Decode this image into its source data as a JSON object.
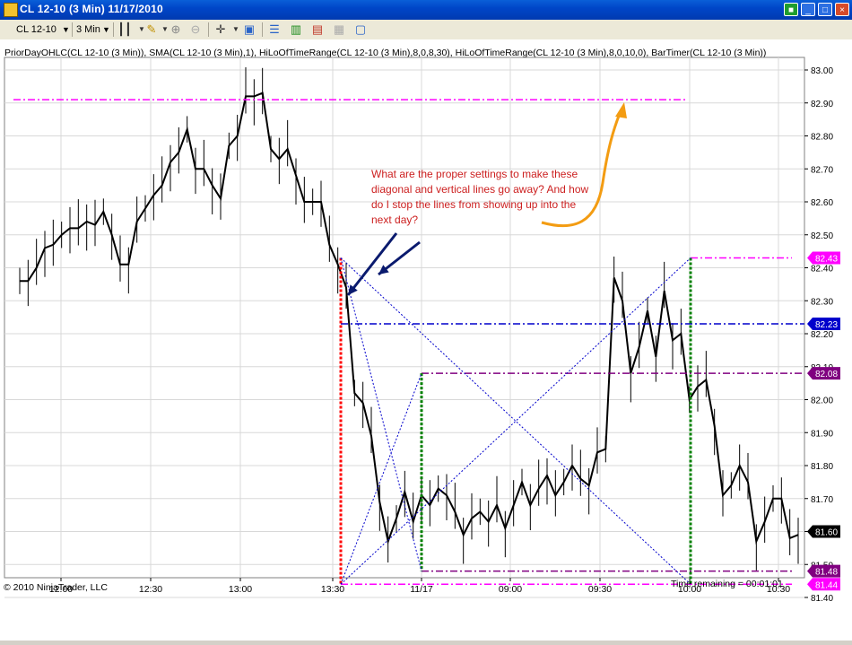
{
  "window": {
    "title": "CL 12-10 (3 Min)  11/17/2010",
    "icons": [
      "app-icon",
      "status-green-icon",
      "minimize-icon",
      "maximize-icon",
      "close-icon"
    ]
  },
  "toolbar": {
    "instrument": "CL 12-10",
    "interval": "3 Min"
  },
  "indicators_text": "PriorDayOHLC(CL 12-10 (3 Min)), SMA(CL 12-10 (3 Min),1), HiLoOfTimeRange(CL 12-10 (3 Min),8,0,8,30), HiLoOfTimeRange(CL 12-10 (3 Min),8,0,10,0), BarTimer(CL 12-10 (3 Min))",
  "annotation": "What are the proper settings to make these diagonal and vertical lines go away? And how do I stop the lines from showing up into the next day?",
  "footer": {
    "copyright": "© 2010 NinjaTrader, LLC",
    "timer": "Time remaining = 00:01:01"
  },
  "colors": {
    "magenta": "#ff00ff",
    "blue": "#0000cc",
    "purple": "#800080",
    "green": "#008000",
    "red": "#ff0000",
    "arrow_navy": "#0a1a6e",
    "arrow_orange": "#f39c12"
  },
  "chart_data": {
    "type": "line",
    "title": "",
    "y_ticks": [
      "83.00",
      "82.90",
      "82.80",
      "82.70",
      "82.60",
      "82.50",
      "82.40",
      "82.30",
      "82.20",
      "82.10",
      "82.00",
      "81.90",
      "81.80",
      "81.70",
      "81.60",
      "81.50",
      "81.40"
    ],
    "x_ticks": [
      "12:00",
      "12:30",
      "13:00",
      "13:30",
      "11/17",
      "09:00",
      "09:30",
      "10:00",
      "10:30"
    ],
    "ylim": [
      81.38,
      83.04
    ],
    "series": [
      {
        "values": [
          82.36,
          82.36,
          82.4,
          82.46,
          82.47,
          82.5,
          82.52,
          82.52,
          82.54,
          82.53,
          82.57,
          82.5,
          82.41,
          82.41,
          82.54,
          82.58,
          82.62,
          82.65,
          82.72,
          82.75,
          82.82,
          82.7,
          82.7,
          82.65,
          82.61,
          82.77,
          82.8,
          82.92,
          82.92,
          82.93,
          82.76,
          82.73,
          82.76,
          82.68,
          82.6,
          82.6,
          82.6,
          82.47,
          82.41,
          82.34,
          82.02,
          81.99,
          81.89,
          81.69,
          81.57,
          81.64,
          81.72,
          81.63,
          81.71,
          81.68,
          81.73,
          81.71,
          81.66,
          81.59,
          81.64,
          81.66,
          81.63,
          81.68,
          81.61,
          81.68,
          81.75,
          81.68,
          81.73,
          81.77,
          81.71,
          81.75,
          81.8,
          81.76,
          81.74,
          81.84,
          81.85,
          82.37,
          82.3,
          82.08,
          82.16,
          82.27,
          82.13,
          82.33,
          82.18,
          82.2,
          82.0,
          82.04,
          82.06,
          81.92,
          81.71,
          81.74,
          81.8,
          81.75,
          81.57,
          81.63,
          81.7,
          81.7,
          81.58,
          81.59
        ]
      }
    ],
    "reference_lines": [
      {
        "label": "",
        "value": 82.91,
        "color": "#ff00ff"
      },
      {
        "label": "82.43",
        "value": 82.43,
        "color": "#ff00ff"
      },
      {
        "label": "82.23",
        "value": 82.23,
        "color": "#0000cc"
      },
      {
        "label": "82.08",
        "value": 82.08,
        "color": "#800080"
      },
      {
        "label": "81.48",
        "value": 81.48,
        "color": "#800080"
      },
      {
        "label": "81.44",
        "value": 81.44,
        "color": "#ff00ff"
      }
    ],
    "last_price": "81.60"
  }
}
